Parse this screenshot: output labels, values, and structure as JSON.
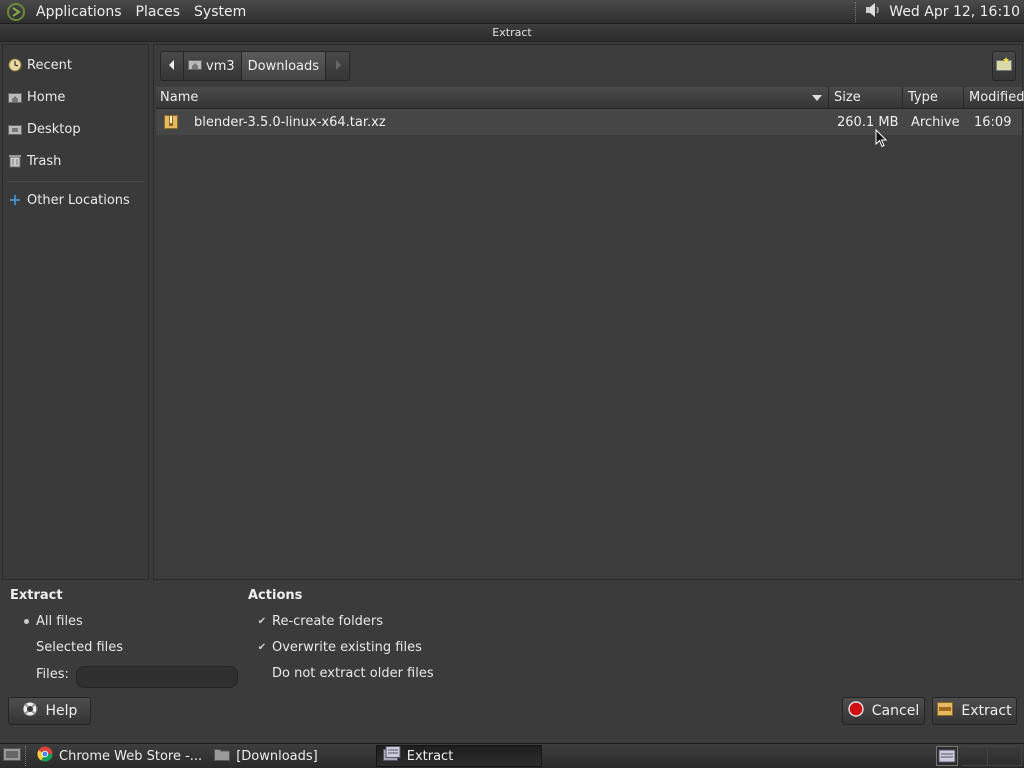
{
  "top_panel": {
    "menus": [
      "Applications",
      "Places",
      "System"
    ],
    "clock": "Wed Apr 12, 16:10"
  },
  "window": {
    "title": "Extract"
  },
  "sidebar": {
    "items": [
      {
        "label": "Recent",
        "icon": "recent-icon"
      },
      {
        "label": "Home",
        "icon": "home-folder-icon"
      },
      {
        "label": "Desktop",
        "icon": "desktop-folder-icon"
      },
      {
        "label": "Trash",
        "icon": "trash-icon"
      }
    ],
    "other_locations": {
      "label": "Other Locations",
      "icon": "plus-icon"
    }
  },
  "pathbar": {
    "segments": [
      "vm3",
      "Downloads"
    ]
  },
  "columns": {
    "name": "Name",
    "size": "Size",
    "type": "Type",
    "modified": "Modified"
  },
  "files": [
    {
      "name": "blender-3.5.0-linux-x64.tar.xz",
      "size": "260.1 MB",
      "type": "Archive",
      "modified": "16:09",
      "icon": "archive-icon"
    }
  ],
  "extract_options": {
    "title": "Extract",
    "all_files": "All files",
    "selected_files": "Selected files",
    "files_label": "Files:",
    "files_value": ""
  },
  "actions": {
    "title": "Actions",
    "recreate_folders": "Re-create folders",
    "overwrite_existing": "Overwrite existing files",
    "no_older": "Do not extract older files"
  },
  "buttons": {
    "help": "Help",
    "cancel": "Cancel",
    "extract": "Extract"
  },
  "taskbar": {
    "tasks": [
      {
        "label": "Chrome Web Store -...",
        "icon": "chrome-icon"
      },
      {
        "label": "[Downloads]",
        "icon": "folder-icon"
      },
      {
        "label": "Extract",
        "icon": "archive-manager-icon"
      }
    ]
  },
  "colors": {
    "background": "#3b3b3b",
    "selected_row": "#464646",
    "cancel_red": "#d01010"
  }
}
